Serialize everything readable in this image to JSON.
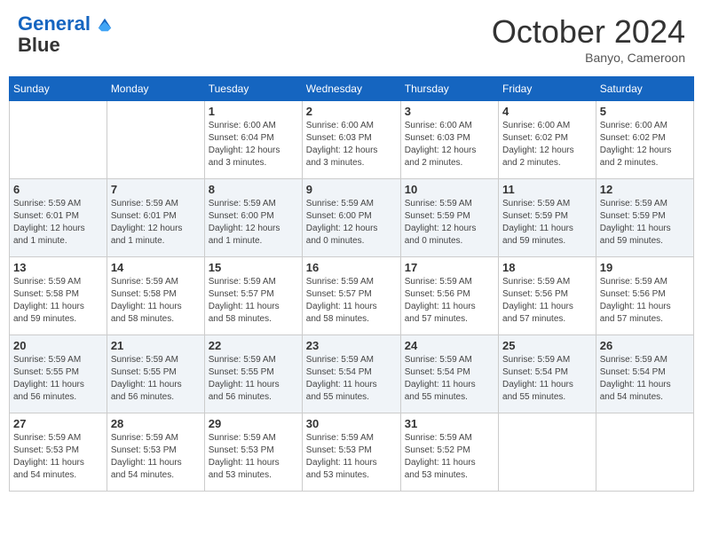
{
  "header": {
    "logo_line1": "General",
    "logo_line2": "Blue",
    "month": "October 2024",
    "location": "Banyo, Cameroon"
  },
  "weekdays": [
    "Sunday",
    "Monday",
    "Tuesday",
    "Wednesday",
    "Thursday",
    "Friday",
    "Saturday"
  ],
  "weeks": [
    [
      {
        "day": "",
        "info": ""
      },
      {
        "day": "",
        "info": ""
      },
      {
        "day": "1",
        "info": "Sunrise: 6:00 AM\nSunset: 6:04 PM\nDaylight: 12 hours\nand 3 minutes."
      },
      {
        "day": "2",
        "info": "Sunrise: 6:00 AM\nSunset: 6:03 PM\nDaylight: 12 hours\nand 3 minutes."
      },
      {
        "day": "3",
        "info": "Sunrise: 6:00 AM\nSunset: 6:03 PM\nDaylight: 12 hours\nand 2 minutes."
      },
      {
        "day": "4",
        "info": "Sunrise: 6:00 AM\nSunset: 6:02 PM\nDaylight: 12 hours\nand 2 minutes."
      },
      {
        "day": "5",
        "info": "Sunrise: 6:00 AM\nSunset: 6:02 PM\nDaylight: 12 hours\nand 2 minutes."
      }
    ],
    [
      {
        "day": "6",
        "info": "Sunrise: 5:59 AM\nSunset: 6:01 PM\nDaylight: 12 hours\nand 1 minute."
      },
      {
        "day": "7",
        "info": "Sunrise: 5:59 AM\nSunset: 6:01 PM\nDaylight: 12 hours\nand 1 minute."
      },
      {
        "day": "8",
        "info": "Sunrise: 5:59 AM\nSunset: 6:00 PM\nDaylight: 12 hours\nand 1 minute."
      },
      {
        "day": "9",
        "info": "Sunrise: 5:59 AM\nSunset: 6:00 PM\nDaylight: 12 hours\nand 0 minutes."
      },
      {
        "day": "10",
        "info": "Sunrise: 5:59 AM\nSunset: 5:59 PM\nDaylight: 12 hours\nand 0 minutes."
      },
      {
        "day": "11",
        "info": "Sunrise: 5:59 AM\nSunset: 5:59 PM\nDaylight: 11 hours\nand 59 minutes."
      },
      {
        "day": "12",
        "info": "Sunrise: 5:59 AM\nSunset: 5:59 PM\nDaylight: 11 hours\nand 59 minutes."
      }
    ],
    [
      {
        "day": "13",
        "info": "Sunrise: 5:59 AM\nSunset: 5:58 PM\nDaylight: 11 hours\nand 59 minutes."
      },
      {
        "day": "14",
        "info": "Sunrise: 5:59 AM\nSunset: 5:58 PM\nDaylight: 11 hours\nand 58 minutes."
      },
      {
        "day": "15",
        "info": "Sunrise: 5:59 AM\nSunset: 5:57 PM\nDaylight: 11 hours\nand 58 minutes."
      },
      {
        "day": "16",
        "info": "Sunrise: 5:59 AM\nSunset: 5:57 PM\nDaylight: 11 hours\nand 58 minutes."
      },
      {
        "day": "17",
        "info": "Sunrise: 5:59 AM\nSunset: 5:56 PM\nDaylight: 11 hours\nand 57 minutes."
      },
      {
        "day": "18",
        "info": "Sunrise: 5:59 AM\nSunset: 5:56 PM\nDaylight: 11 hours\nand 57 minutes."
      },
      {
        "day": "19",
        "info": "Sunrise: 5:59 AM\nSunset: 5:56 PM\nDaylight: 11 hours\nand 57 minutes."
      }
    ],
    [
      {
        "day": "20",
        "info": "Sunrise: 5:59 AM\nSunset: 5:55 PM\nDaylight: 11 hours\nand 56 minutes."
      },
      {
        "day": "21",
        "info": "Sunrise: 5:59 AM\nSunset: 5:55 PM\nDaylight: 11 hours\nand 56 minutes."
      },
      {
        "day": "22",
        "info": "Sunrise: 5:59 AM\nSunset: 5:55 PM\nDaylight: 11 hours\nand 56 minutes."
      },
      {
        "day": "23",
        "info": "Sunrise: 5:59 AM\nSunset: 5:54 PM\nDaylight: 11 hours\nand 55 minutes."
      },
      {
        "day": "24",
        "info": "Sunrise: 5:59 AM\nSunset: 5:54 PM\nDaylight: 11 hours\nand 55 minutes."
      },
      {
        "day": "25",
        "info": "Sunrise: 5:59 AM\nSunset: 5:54 PM\nDaylight: 11 hours\nand 55 minutes."
      },
      {
        "day": "26",
        "info": "Sunrise: 5:59 AM\nSunset: 5:54 PM\nDaylight: 11 hours\nand 54 minutes."
      }
    ],
    [
      {
        "day": "27",
        "info": "Sunrise: 5:59 AM\nSunset: 5:53 PM\nDaylight: 11 hours\nand 54 minutes."
      },
      {
        "day": "28",
        "info": "Sunrise: 5:59 AM\nSunset: 5:53 PM\nDaylight: 11 hours\nand 54 minutes."
      },
      {
        "day": "29",
        "info": "Sunrise: 5:59 AM\nSunset: 5:53 PM\nDaylight: 11 hours\nand 53 minutes."
      },
      {
        "day": "30",
        "info": "Sunrise: 5:59 AM\nSunset: 5:53 PM\nDaylight: 11 hours\nand 53 minutes."
      },
      {
        "day": "31",
        "info": "Sunrise: 5:59 AM\nSunset: 5:52 PM\nDaylight: 11 hours\nand 53 minutes."
      },
      {
        "day": "",
        "info": ""
      },
      {
        "day": "",
        "info": ""
      }
    ]
  ]
}
